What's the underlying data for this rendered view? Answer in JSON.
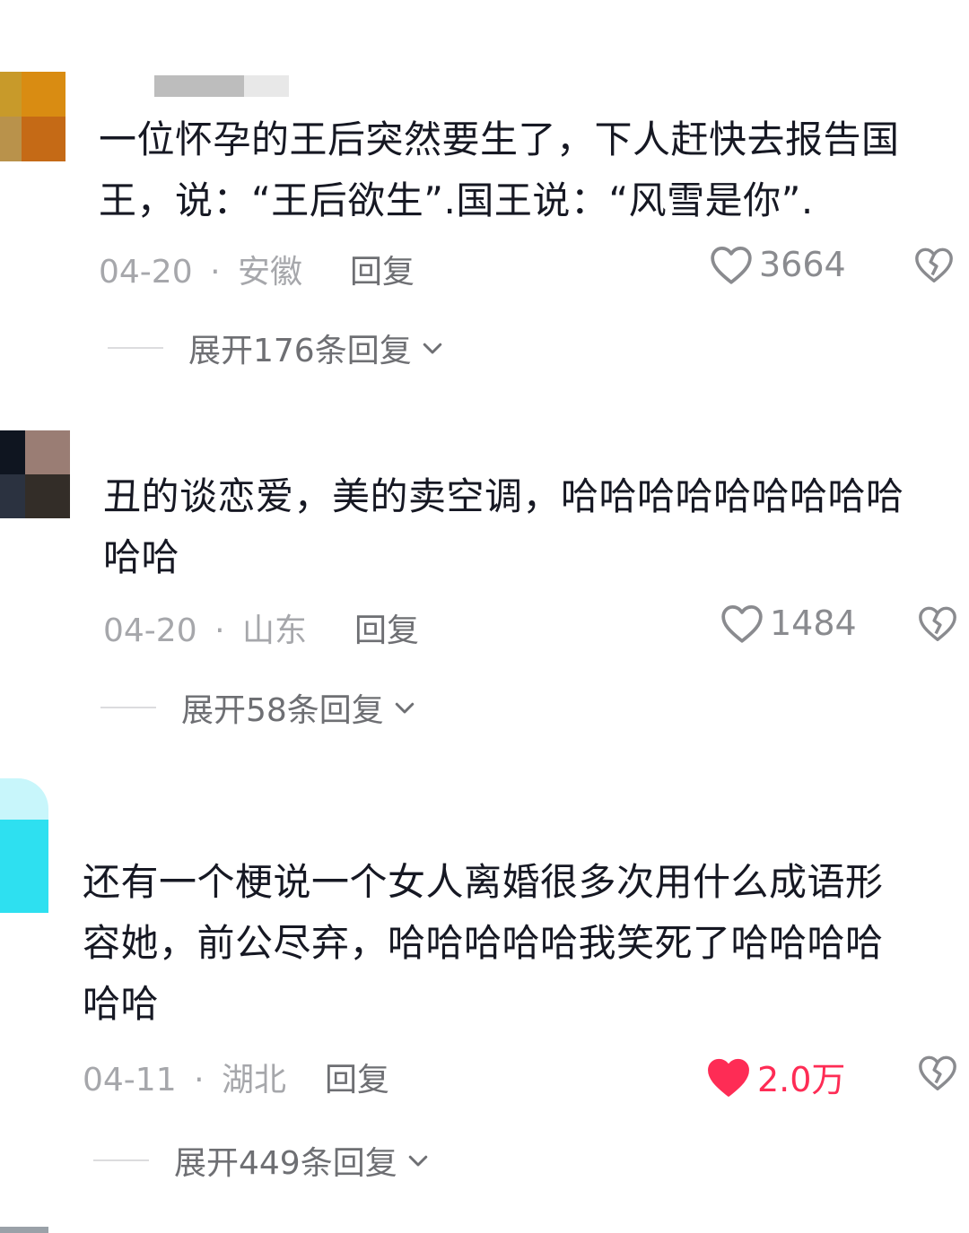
{
  "comments": [
    {
      "lines": [
        "一位怀孕的王后突然要生了，下人赶快去报告国",
        "王，说：“王后欲生”.国王说：“风雪是你”."
      ],
      "date": "04-20",
      "location": "安徽",
      "reply_label": "回复",
      "likes": "3664",
      "liked": false,
      "expand_label": "展开176条回复"
    },
    {
      "lines": [
        "丑的谈恋爱，美的卖空调，哈哈哈哈哈哈哈哈哈",
        "哈哈"
      ],
      "date": "04-20",
      "location": "山东",
      "reply_label": "回复",
      "likes": "1484",
      "liked": false,
      "expand_label": "展开58条回复"
    },
    {
      "lines": [
        "还有一个梗说一个女人离婚很多次用什么成语形",
        "容她，前公尽弃，哈哈哈哈哈我笑死了哈哈哈哈",
        "哈哈"
      ],
      "date": "04-11",
      "location": "湖北",
      "reply_label": "回复",
      "likes": "2.0万",
      "liked": true,
      "expand_label": "展开449条回复"
    }
  ],
  "separator": "·",
  "colors": {
    "like_active": "#fe2c55",
    "muted": "#a6a7ab",
    "text": "#161823"
  },
  "icons": {
    "like": "heart-icon",
    "dislike": "broken-heart-icon",
    "expand": "chevron-down-icon"
  }
}
